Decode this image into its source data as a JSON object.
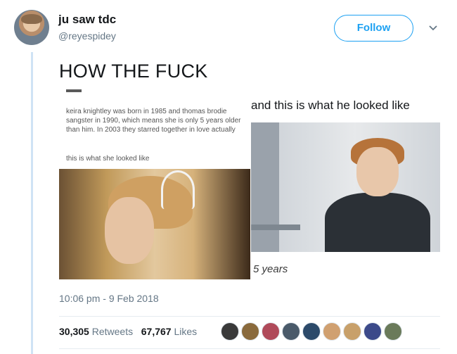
{
  "user": {
    "display_name": "ju saw tdc",
    "handle": "@reyespidey",
    "follow_label": "Follow"
  },
  "tweet": {
    "text": "HOW THE FUCK",
    "timestamp": "10:06 pm - 9 Feb 2018",
    "retweets_count": "30,305",
    "retweets_label": "Retweets",
    "likes_count": "67,767",
    "likes_label": "Likes"
  },
  "media": {
    "left_text": "keira knightley was born in 1985 and thomas brodie sangster in 1990, which means she is only 5 years older than him. In 2003 they starred together in love actually",
    "left_caption": "this is what she looked like",
    "right_caption": "and this is what he looked like",
    "years_caption": "5 years"
  },
  "likers": [
    {
      "color": "#3a3a3a"
    },
    {
      "color": "#8a6a3c"
    },
    {
      "color": "#b04a5a"
    },
    {
      "color": "#4a5a6a"
    },
    {
      "color": "#2c4a6a"
    },
    {
      "color": "#d0a070"
    },
    {
      "color": "#c8a06a"
    },
    {
      "color": "#3c4a8a"
    },
    {
      "color": "#6a7a5a"
    }
  ],
  "colors": {
    "accent": "#1da1f2",
    "thread_line": "#cfe3f5",
    "muted_text": "#657786"
  }
}
